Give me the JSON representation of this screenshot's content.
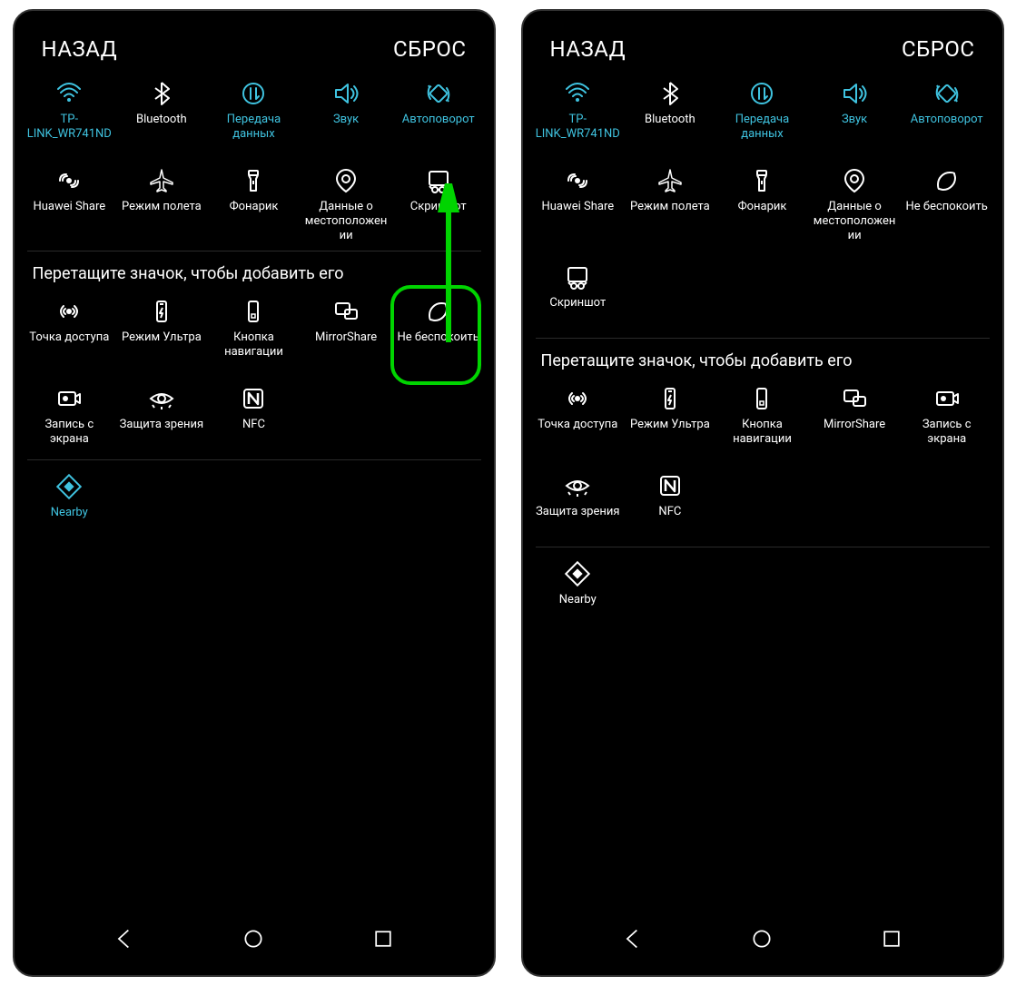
{
  "colors": {
    "accent": "#3fc3e0",
    "highlight": "#00d400"
  },
  "common": {
    "header": {
      "back": "НАЗАД",
      "reset": "СБРОС"
    },
    "drag_prompt": "Перетащите значок, чтобы добавить его"
  },
  "left": {
    "active_tiles": [
      {
        "icon": "wifi",
        "label": "TP-LINK_WR741ND",
        "accent": true
      },
      {
        "icon": "bluetooth",
        "label": "Bluetooth",
        "accent": false
      },
      {
        "icon": "data",
        "label": "Передача данных",
        "accent": true
      },
      {
        "icon": "sound",
        "label": "Звук",
        "accent": true
      },
      {
        "icon": "rotate",
        "label": "Автоповорот",
        "accent": true
      },
      {
        "icon": "huawei-share",
        "label": "Huawei Share",
        "accent": false
      },
      {
        "icon": "airplane",
        "label": "Режим полета",
        "accent": false
      },
      {
        "icon": "flashlight",
        "label": "Фонарик",
        "accent": false
      },
      {
        "icon": "location",
        "label": "Данные о местоположении",
        "accent": false
      },
      {
        "icon": "screenshot",
        "label": "Скриншот",
        "accent": false
      }
    ],
    "inactive_tiles": [
      {
        "icon": "hotspot",
        "label": "Точка доступа"
      },
      {
        "icon": "ultra",
        "label": "Режим Ультра"
      },
      {
        "icon": "navkey",
        "label": "Кнопка навигации"
      },
      {
        "icon": "mirrorshare",
        "label": "MirrorShare"
      },
      {
        "icon": "dnd",
        "label": "Не беспокоить",
        "highlighted": true
      },
      {
        "icon": "screenrec",
        "label": "Запись с экрана"
      },
      {
        "icon": "eyecare",
        "label": "Защита зрения"
      },
      {
        "icon": "nfc",
        "label": "NFC"
      }
    ],
    "extra_tiles": [
      {
        "icon": "nearby",
        "label": "Nearby",
        "accent": true
      }
    ]
  },
  "right": {
    "active_tiles": [
      {
        "icon": "wifi",
        "label": "TP-LINK_WR741ND",
        "accent": true
      },
      {
        "icon": "bluetooth",
        "label": "Bluetooth",
        "accent": false
      },
      {
        "icon": "data",
        "label": "Передача данных",
        "accent": true
      },
      {
        "icon": "sound",
        "label": "Звук",
        "accent": true
      },
      {
        "icon": "rotate",
        "label": "Автоповорот",
        "accent": true
      },
      {
        "icon": "huawei-share",
        "label": "Huawei Share",
        "accent": false
      },
      {
        "icon": "airplane",
        "label": "Режим полета",
        "accent": false
      },
      {
        "icon": "flashlight",
        "label": "Фонарик",
        "accent": false
      },
      {
        "icon": "location",
        "label": "Данные о местоположении",
        "accent": false
      },
      {
        "icon": "dnd",
        "label": "Не беспокоить",
        "accent": false
      },
      {
        "icon": "screenshot",
        "label": "Скриншот",
        "accent": false
      }
    ],
    "inactive_tiles": [
      {
        "icon": "hotspot",
        "label": "Точка доступа"
      },
      {
        "icon": "ultra",
        "label": "Режим Ультра"
      },
      {
        "icon": "navkey",
        "label": "Кнопка навигации"
      },
      {
        "icon": "mirrorshare",
        "label": "MirrorShare"
      },
      {
        "icon": "screenrec",
        "label": "Запись с экрана"
      },
      {
        "icon": "eyecare",
        "label": "Защита зрения"
      },
      {
        "icon": "nfc",
        "label": "NFC"
      }
    ],
    "extra_tiles": [
      {
        "icon": "nearby",
        "label": "Nearby",
        "accent": false
      }
    ]
  }
}
